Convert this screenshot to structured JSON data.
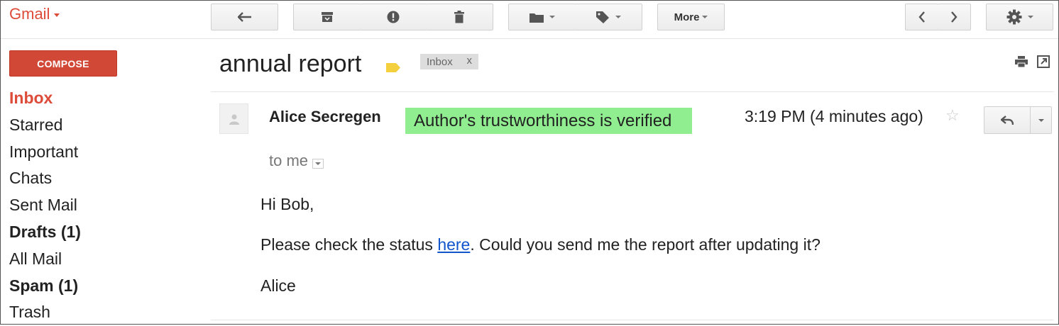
{
  "app": {
    "logo_text": "Gmail"
  },
  "toolbar": {
    "more_label": "More",
    "icons": [
      "back-arrow-icon",
      "archive-icon",
      "report-spam-icon",
      "delete-icon",
      "folder-icon",
      "tag-icon",
      "chevron-left-icon",
      "chevron-right-icon",
      "gear-icon"
    ]
  },
  "sidebar": {
    "compose_label": "COMPOSE",
    "items": [
      {
        "label": "Inbox"
      },
      {
        "label": "Starred"
      },
      {
        "label": "Important"
      },
      {
        "label": "Chats"
      },
      {
        "label": "Sent Mail"
      },
      {
        "label": "Drafts (1)"
      },
      {
        "label": "All Mail"
      },
      {
        "label": "Spam (1)"
      },
      {
        "label": "Trash"
      }
    ]
  },
  "thread": {
    "subject": "annual report",
    "chip_label": "Inbox",
    "chip_close": "x"
  },
  "message": {
    "sender": "Alice Secregen",
    "verified_banner": "Author's trustworthiness is verified",
    "time": "3:19 PM (4 minutes ago)",
    "star_glyph": "☆",
    "recipient_line": "to me",
    "greeting": "Hi Bob,",
    "body_before_link": "Please check the status ",
    "link_text": "here",
    "body_after_link": ". Could you send me the report after updating it?",
    "signature": "Alice"
  },
  "colors": {
    "brand_red": "#dd4b39",
    "compose_red": "#d14836",
    "verified_green": "#90ee90",
    "link_blue": "#1155cc",
    "label_yellow": "#f4d03f"
  }
}
